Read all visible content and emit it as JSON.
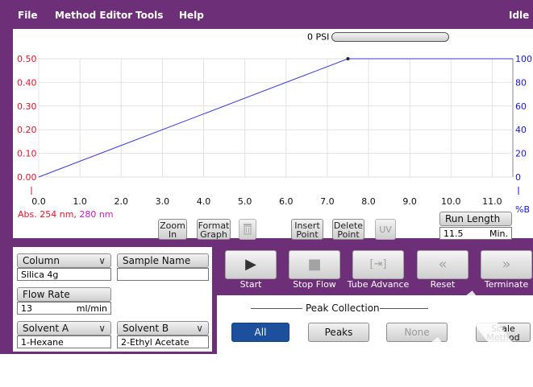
{
  "menu": {
    "file": "File",
    "method_editor": "Method Editor",
    "tools": "Tools",
    "help": "Help",
    "status": "Idle"
  },
  "pressure": {
    "value": "0 PSI",
    "level_fraction": 0
  },
  "graph": {
    "left_axis_ticks": [
      "0.50",
      "0.40",
      "0.30",
      "0.20",
      "0.10",
      "0.00"
    ],
    "right_axis_ticks": [
      "100",
      "80",
      "60",
      "40",
      "20",
      "0"
    ],
    "x_axis_ticks": [
      "0.0",
      "1.0",
      "2.0",
      "3.0",
      "4.0",
      "5.0",
      "6.0",
      "7.0",
      "8.0",
      "9.0",
      "10.0",
      "11.0"
    ],
    "right_unit": "%B",
    "legend_abs": "Abs. 254 nm,",
    "legend_nm2": "280 nm",
    "colors": {
      "left_axis": "#e0142a",
      "right_axis": "#1515e0",
      "line": "#3a3ad8"
    }
  },
  "chart_data": {
    "type": "line",
    "series": [
      {
        "x": [
          0.0,
          7.5,
          11.5
        ],
        "y": [
          0,
          100,
          100
        ]
      }
    ],
    "xlim": [
      0,
      11.5
    ],
    "ylim_right": [
      0,
      100
    ],
    "ylim_left": [
      0.0,
      0.5
    ],
    "grid": true
  },
  "graph_buttons": {
    "zoom_in": "Zoom In",
    "format_graph": "Format Graph",
    "trash": "trash-icon",
    "insert_point": "Insert Point",
    "delete_point": "Delete Point",
    "uv": "UV"
  },
  "run_length": {
    "label": "Run Length",
    "value": "11.5",
    "unit": "Min."
  },
  "params": {
    "column_label": "Column",
    "column_value": "Silica 4g",
    "sample_name_label": "Sample Name",
    "sample_name_value": "",
    "flow_rate_label": "Flow Rate",
    "flow_rate_value": "13",
    "flow_rate_unit": "ml/min",
    "solvent_a_label": "Solvent A",
    "solvent_a_value": "1-Hexane",
    "solvent_b_label": "Solvent B",
    "solvent_b_value": "2-Ethyl Acetate"
  },
  "controls": {
    "start": "Start",
    "stop_flow": "Stop Flow",
    "tube_advance": "Tube Advance",
    "reset": "Reset",
    "terminate": "Terminate"
  },
  "peak_collection": {
    "title": "Peak Collection",
    "all": "All",
    "peaks": "Peaks",
    "none": "None",
    "scale_method": "Scale Method"
  }
}
